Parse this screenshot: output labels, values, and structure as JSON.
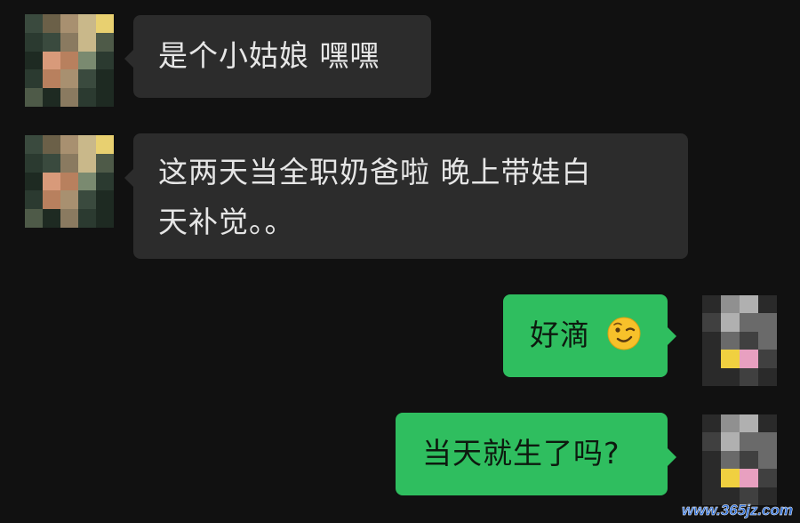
{
  "conversation": {
    "messages": [
      {
        "direction": "incoming",
        "text": "是个小姑娘 嘿嘿"
      },
      {
        "direction": "incoming",
        "text": "这两天当全职奶爸啦  晚上带娃白天补觉。。",
        "lines": [
          "这两天当全职奶爸啦  晚上带娃白",
          "天补觉。。"
        ]
      },
      {
        "direction": "outgoing",
        "text": "好滴",
        "emoji": "wink-emoji"
      },
      {
        "direction": "outgoing",
        "text": "当天就生了吗?"
      }
    ]
  },
  "avatars": {
    "contact": {
      "icon": "pixelated-avatar",
      "palette": [
        "#3a4a3e",
        "#6b6048",
        "#c9b88a",
        "#e8d070",
        "#2b3a30",
        "#8a7a60",
        "#b8805e",
        "#d89a7a",
        "#4e5a48",
        "#1e2a22",
        "#a89070",
        "#7a8a70"
      ]
    },
    "self": {
      "icon": "pixelated-avatar",
      "palette": [
        "#2a2a2a",
        "#6a6a6a",
        "#b0b0b0",
        "#f0d040",
        "#e8a0c0",
        "#404040",
        "#909090"
      ]
    }
  },
  "colors": {
    "background": "#111111",
    "incoming_bubble": "#2c2c2c",
    "outgoing_bubble": "#2fbe5f"
  },
  "watermark": "www.365jz.com"
}
